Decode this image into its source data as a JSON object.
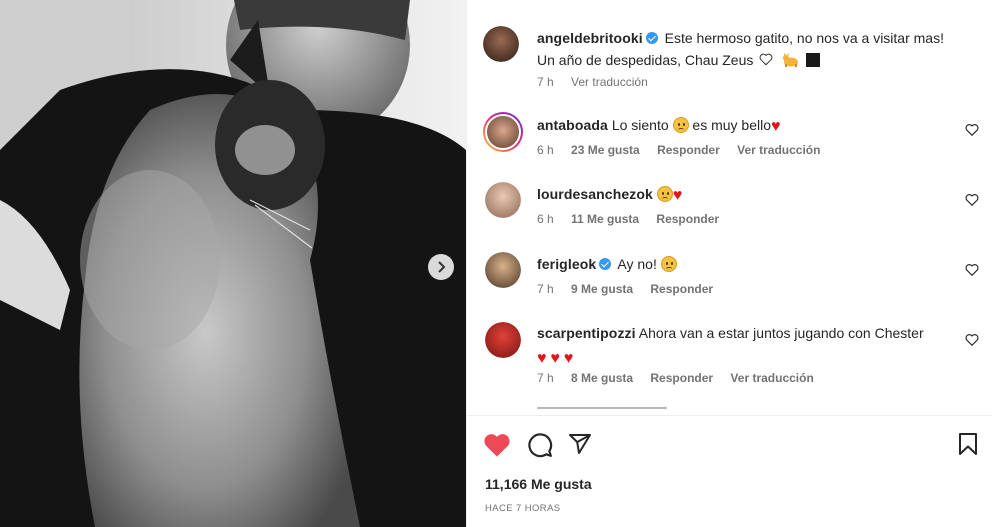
{
  "post": {
    "author": "angeldebritooki",
    "caption_line1": "Este hermoso gatito, no nos va a visitar mas!",
    "caption_line2": "Un año de despedidas, Chau Zeus",
    "time": "7 h",
    "see_translation": "Ver traducción",
    "likes": "11,166 Me gusta",
    "time_ago": "HACE 7 HORAS"
  },
  "comments": [
    {
      "user": "antaboada",
      "text": "Lo siento",
      "text_after": "es muy bello",
      "time": "6 h",
      "likes": "23 Me gusta",
      "reply": "Responder",
      "translate": "Ver traducción"
    },
    {
      "user": "lourdesanchezok",
      "time": "6 h",
      "likes": "11 Me gusta",
      "reply": "Responder"
    },
    {
      "user": "ferigleok",
      "text": "Ay no!",
      "time": "7 h",
      "likes": "9 Me gusta",
      "reply": "Responder"
    },
    {
      "user": "scarpentipozzi",
      "text": "Ahora van a estar juntos jugando con Chester",
      "time": "7 h",
      "likes": "8 Me gusta",
      "reply": "Responder",
      "translate": "Ver traducción"
    }
  ],
  "icons": {
    "verified": "verified-badge-icon",
    "like": "heart-icon",
    "comment": "comment-icon",
    "share": "share-icon",
    "save": "bookmark-icon",
    "next": "chevron-right-icon"
  },
  "colors": {
    "like_red": "#ed4956",
    "verified_blue": "#3897f0",
    "meta_gray": "#737373"
  }
}
